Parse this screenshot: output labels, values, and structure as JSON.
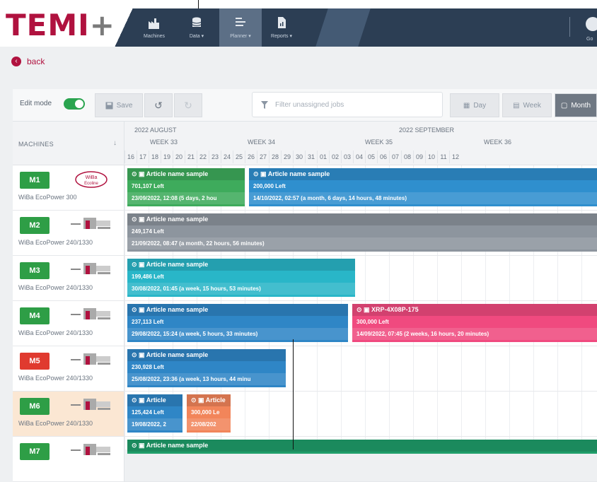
{
  "brand": {
    "logo": "TEMI",
    "logo_plus": "+"
  },
  "nav": [
    {
      "label": "Machines",
      "icon": "factory-icon"
    },
    {
      "label": "Data ▾",
      "icon": "database-icon"
    },
    {
      "label": "Planner ▾",
      "icon": "list-icon"
    },
    {
      "label": "Reports ▾",
      "icon": "report-icon"
    }
  ],
  "user": {
    "label": "Go"
  },
  "back": {
    "label": "back"
  },
  "toolbar": {
    "edit_mode": "Edit mode",
    "save": "Save",
    "undo": "↺",
    "redo": "↻",
    "filter_placeholder": "Filter unassigned jobs",
    "day": "Day",
    "week": "Week",
    "month": "Month"
  },
  "grid": {
    "machines_header": "MACHINES",
    "months": [
      "2022 AUGUST",
      "2022 SEPTEMBER"
    ],
    "weeks": [
      "WEEK 33",
      "WEEK 34",
      "WEEK 35",
      "WEEK 36"
    ],
    "days": [
      "16",
      "17",
      "18",
      "19",
      "20",
      "21",
      "22",
      "23",
      "24",
      "25",
      "26",
      "27",
      "28",
      "29",
      "30",
      "31",
      "01",
      "02",
      "03",
      "04",
      "05",
      "06",
      "07",
      "08",
      "09",
      "10",
      "11",
      "12"
    ]
  },
  "machines": [
    {
      "id": "M1",
      "name": "WiBa EcoPower 300",
      "color": "#2e9e46"
    },
    {
      "id": "M2",
      "name": "WiBa EcoPower 240/1330",
      "color": "#2e9e46"
    },
    {
      "id": "M3",
      "name": "WiBa EcoPower 240/1330",
      "color": "#2e9e46"
    },
    {
      "id": "M4",
      "name": "WiBa EcoPower 240/1330",
      "color": "#2e9e46"
    },
    {
      "id": "M5",
      "name": "WiBa EcoPower 240/1330",
      "color": "#e03a2f"
    },
    {
      "id": "M6",
      "name": "WiBa EcoPower 240/1330",
      "color": "#2e9e46"
    },
    {
      "id": "M7",
      "name": "",
      "color": "#2e9e46"
    }
  ],
  "jobs": [
    {
      "title": "Article name sample",
      "left": "701,107 Left",
      "date": "23/09/2022, 12:08 (5 days, 2 hou",
      "color": "#3eab5c"
    },
    {
      "title": "Article name sample",
      "left": "200,000 Left",
      "date": "14/10/2022, 02:57 (a month, 6 days, 14 hours, 48 minutes)",
      "color": "#2f8fce"
    },
    {
      "title": "Article name sample",
      "left": "249,174 Left",
      "date": "21/09/2022, 08:47 (a month, 22 hours, 56 minutes)",
      "color": "#8d959e"
    },
    {
      "title": "Article name sample",
      "left": "199,486 Left",
      "date": "30/08/2022, 01:45 (a week, 15 hours, 53 minutes)",
      "color": "#29b6c8"
    },
    {
      "title": "Article name sample",
      "left": "237,113 Left",
      "date": "29/08/2022, 15:24 (a week, 5 hours, 33 minutes)",
      "color": "#2f86c6"
    },
    {
      "title": "XRP-4X08P-175",
      "left": "300,000 Left",
      "date": "14/09/2022, 07:45 (2 weeks, 16 hours, 20 minutes)",
      "color": "#f04a7f"
    },
    {
      "title": "Article name sample",
      "left": "230,928 Left",
      "date": "25/08/2022, 23:36 (a week, 13 hours, 44 minu",
      "color": "#2f86c6"
    },
    {
      "title": "Article",
      "left": "125,424 Left",
      "date": "19/08/2022, 2",
      "color": "#2f86c6"
    },
    {
      "title": "Article",
      "left": "300,000 Le",
      "date": "22/08/202",
      "color": "#f2855a"
    },
    {
      "title": "Article name sample",
      "left": "",
      "date": "",
      "color": "#1f9e6a"
    }
  ]
}
